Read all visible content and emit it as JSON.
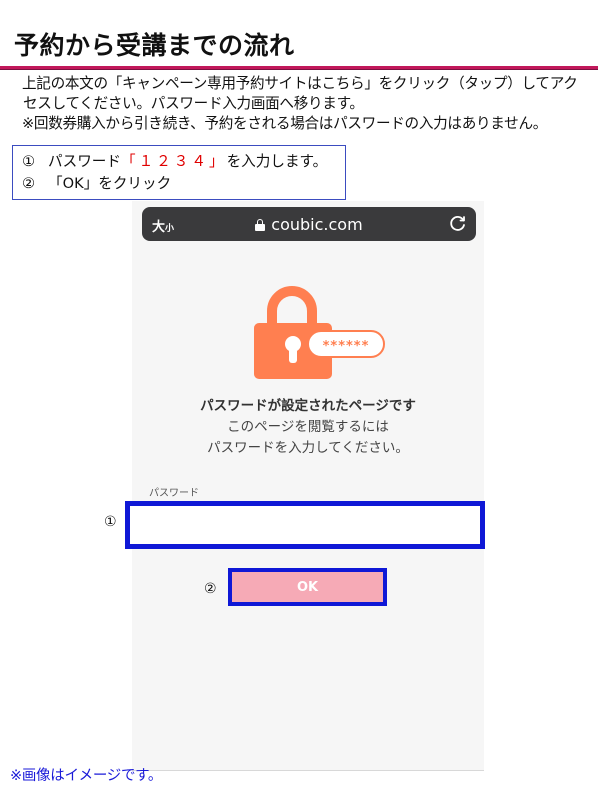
{
  "page": {
    "title": "予約から受講までの流れ",
    "accent_color": "#c2185b",
    "intro_lines": [
      "上記の本文の「キャンペーン専用予約サイトはこちら」をクリック（タップ）してアク",
      "セスしてください。パスワード入力画面へ移ります。",
      "※回数券購入から引き続き、予約をされる場合はパスワードの入力はありません。"
    ]
  },
  "steps": {
    "step1_number": "①",
    "step1_prefix": "パスワード",
    "step1_password": "「１２３４」",
    "step1_suffix": "を入力します。",
    "step2_number": "②",
    "step2_text": "「OK」をクリック"
  },
  "phone": {
    "urlbar": {
      "size_label_big": "大",
      "size_label_small": "小",
      "domain": "coubic.com",
      "lock_icon": "lock-icon",
      "reload_icon": "reload-icon"
    },
    "illustration": {
      "icon": "padlock-icon",
      "password_mask": "******",
      "color": "#ff7f50"
    },
    "message_title": "パスワードが設定されたページです",
    "message_line1": "このページを閲覧するには",
    "message_line2": "パスワードを入力してください。",
    "password_label": "パスワード",
    "password_value": "",
    "ok_label": "OK",
    "ok_color": "#f6aab6",
    "highlight_color": "#0f18d6"
  },
  "markers": {
    "one": "①",
    "two": "②"
  },
  "footnote": "※画像はイメージです。"
}
